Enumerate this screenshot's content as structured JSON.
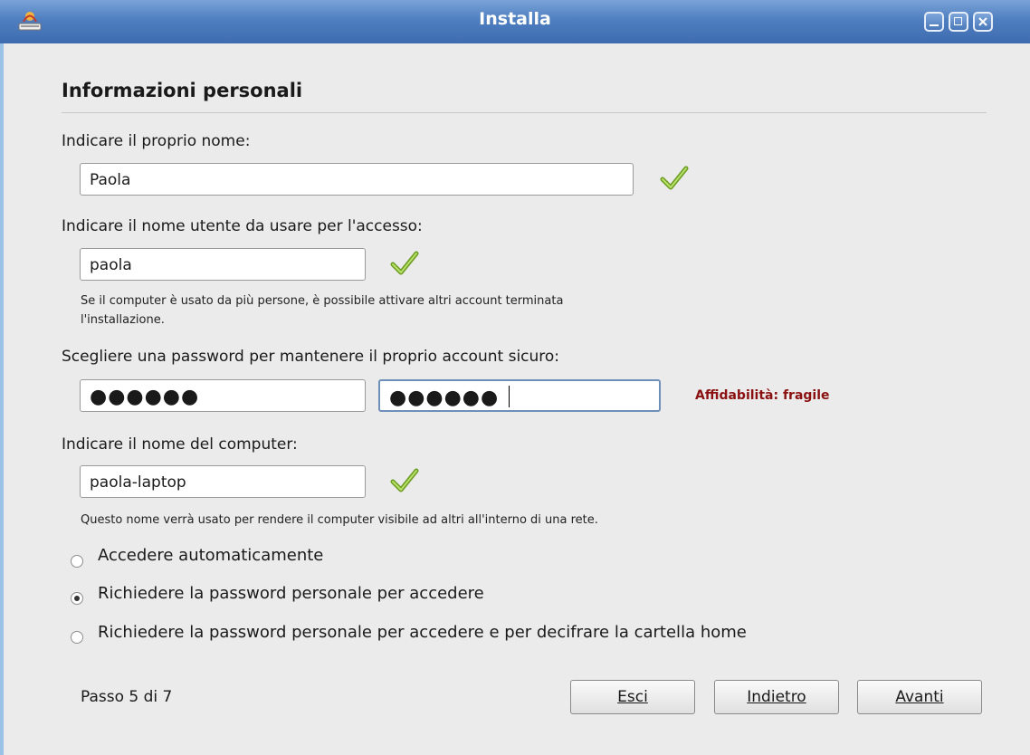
{
  "window": {
    "title": "Installa",
    "controls": [
      "minimize-icon",
      "maximize-icon",
      "close-icon"
    ]
  },
  "section_title": "Informazioni personali",
  "name": {
    "label": "Indicare il proprio nome:",
    "value": "Paola",
    "status_icon": "checkmark-icon"
  },
  "username": {
    "label": "Indicare il nome utente da usare per l'accesso:",
    "value": "paola",
    "status_icon": "checkmark-icon",
    "hint_line1": "Se il computer è usato da più persone, è possibile attivare altri account terminata",
    "hint_line2": "l'installazione."
  },
  "password": {
    "label": "Scegliere una password per mantenere il proprio account sicuro:",
    "masked_value": "●●●●●●",
    "confirm_masked_value": "●●●●●●",
    "strength": "Affidabilità: fragile",
    "strength_color": "#8b1010"
  },
  "computer_name": {
    "label": "Indicare il nome del computer:",
    "value": "paola-laptop",
    "status_icon": "checkmark-icon",
    "hint": "Questo nome verrà usato per rendere il computer visibile ad altri all'interno di una rete."
  },
  "login_options": [
    {
      "label": "Accedere automaticamente",
      "selected": false
    },
    {
      "label": "Richiedere la password personale per accedere",
      "selected": true
    },
    {
      "label": "Richiedere la password personale per accedere e per decifrare la cartella home",
      "selected": false
    }
  ],
  "footer": {
    "step": "Passo 5 di 7",
    "quit": "Esci",
    "back": "Indietro",
    "forward": "Avanti"
  },
  "colors": {
    "titlebar": "#4f7fc0",
    "check": "#8cc63f"
  }
}
